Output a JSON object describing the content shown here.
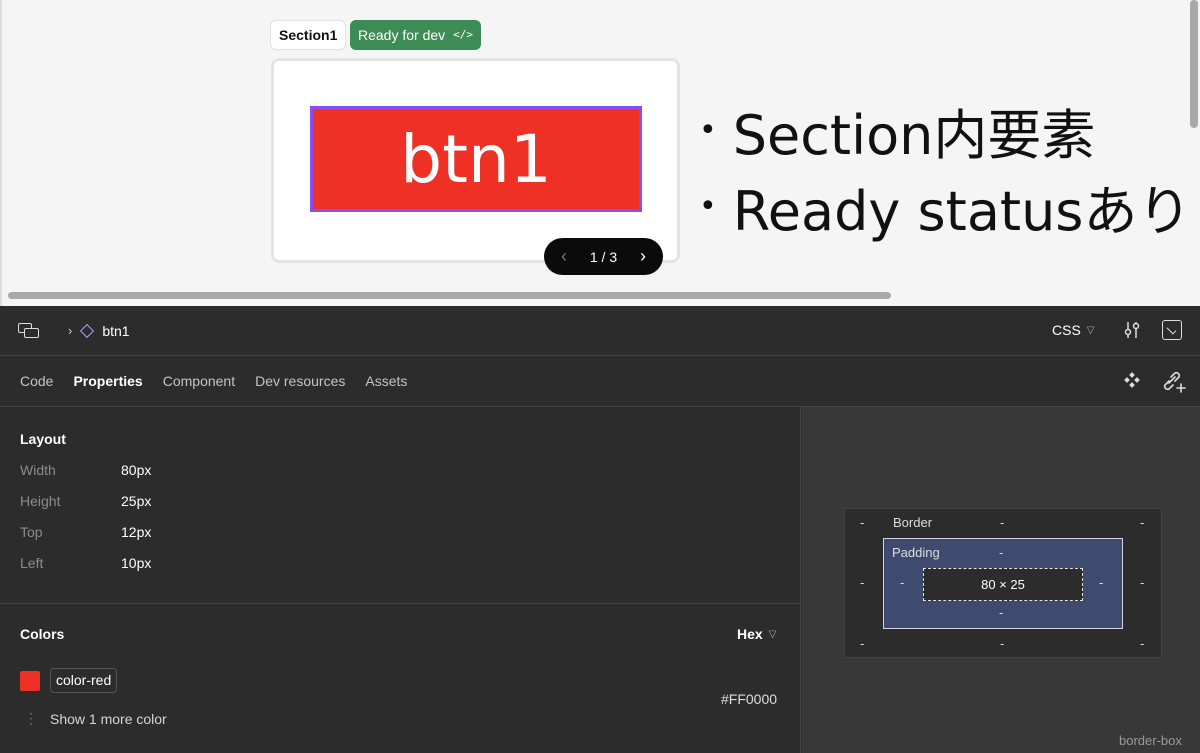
{
  "canvas": {
    "section_label": "Section1",
    "ready_badge": "Ready for dev",
    "ready_icon": "</>",
    "button_text": "btn1",
    "pager": {
      "text": "1 / 3",
      "prev": "‹",
      "next": "›"
    },
    "bullets": [
      "Section内要素",
      "Ready statusあり"
    ],
    "bullet_glyph": "•"
  },
  "topbar": {
    "breadcrumb": "btn1",
    "language": "CSS"
  },
  "tabs": [
    "Code",
    "Properties",
    "Component",
    "Dev resources",
    "Assets"
  ],
  "active_tab": "Properties",
  "layout": {
    "title": "Layout",
    "rows": [
      {
        "key": "Width",
        "value": "80px"
      },
      {
        "key": "Height",
        "value": "25px"
      },
      {
        "key": "Top",
        "value": "12px"
      },
      {
        "key": "Left",
        "value": "10px"
      }
    ]
  },
  "colors": {
    "title": "Colors",
    "format": "Hex",
    "items": [
      {
        "name": "color-red",
        "hex": "#FF0000",
        "swatch": "#ee3124"
      }
    ],
    "more_label": "Show 1 more color"
  },
  "box_model": {
    "border_label": "Border",
    "padding_label": "Padding",
    "dash": "-",
    "content_size": "80 × 25",
    "box_sizing": "border-box"
  },
  "theme": {
    "accent_green": "#3d8c55",
    "button_red": "#ee3124",
    "selection_purple": "#8a4ef0",
    "padding_blue": "#3e4a6e"
  }
}
